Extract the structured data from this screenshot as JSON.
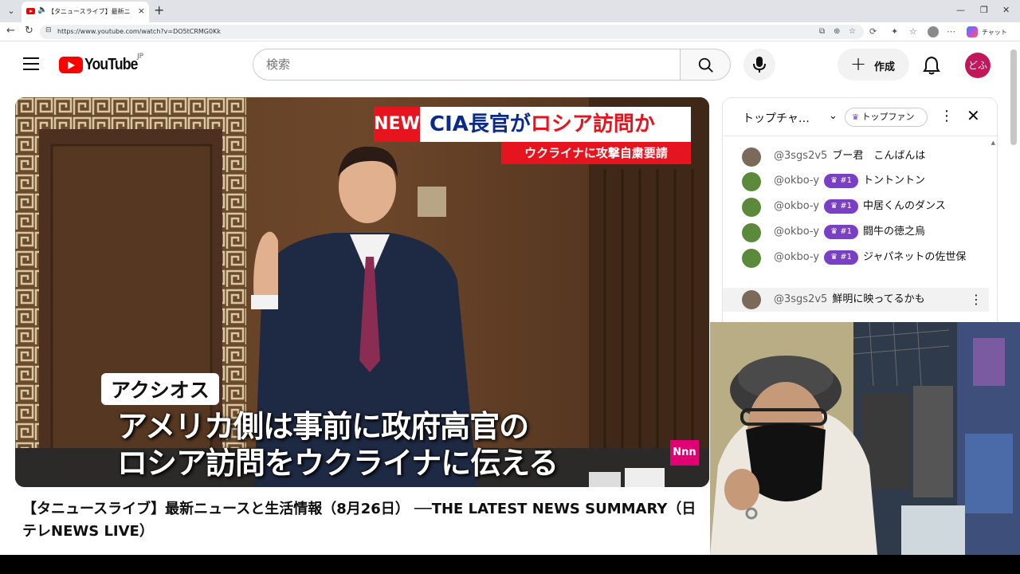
{
  "browser": {
    "tab_title": "【タニュースライブ】最新ニュースと生",
    "url": "https://www.youtube.com/watch?v=DO5tCRMG0Kk",
    "chat_button": "チャット"
  },
  "masthead": {
    "logo_text": "YouTube",
    "region": "JP",
    "search_placeholder": "検索",
    "create_label": "作成",
    "avatar_text": "どふ"
  },
  "video": {
    "headline_badge": "NEW",
    "headline_part1": "CIA長官が",
    "headline_part2": "ロシア訪問か",
    "headline_sub": "ウクライナに攻撃自粛要請",
    "caption_source": "アクシオス",
    "caption_line1": "アメリカ側は事前に政府高官の",
    "caption_line2": "ロシア訪問をウクライナに伝える",
    "channel_mark": "Nnn",
    "title": "【タニュースライブ】最新ニュースと生活情報（8月26日） ──THE LATEST NEWS SUMMARY（日テレNEWS LIVE）"
  },
  "chat": {
    "mode_label": "トップチャ…",
    "fan_filter": "トップファン",
    "messages": [
      {
        "author": "@3sgs2v5",
        "badge": "",
        "text": "ブー君　こんばんは"
      },
      {
        "author": "@okbo-y",
        "badge": "#1",
        "text": "トントントン"
      },
      {
        "author": "@okbo-y",
        "badge": "#1",
        "text": "中居くんのダンス"
      },
      {
        "author": "@okbo-y",
        "badge": "#1",
        "text": "闘牛の徳之烏"
      },
      {
        "author": "@okbo-y",
        "badge": "#1",
        "text": "ジャパネットの佐世保"
      },
      {
        "author": "@3sgs2v5",
        "badge": "",
        "text": "鮮明に映ってるかも"
      }
    ]
  }
}
